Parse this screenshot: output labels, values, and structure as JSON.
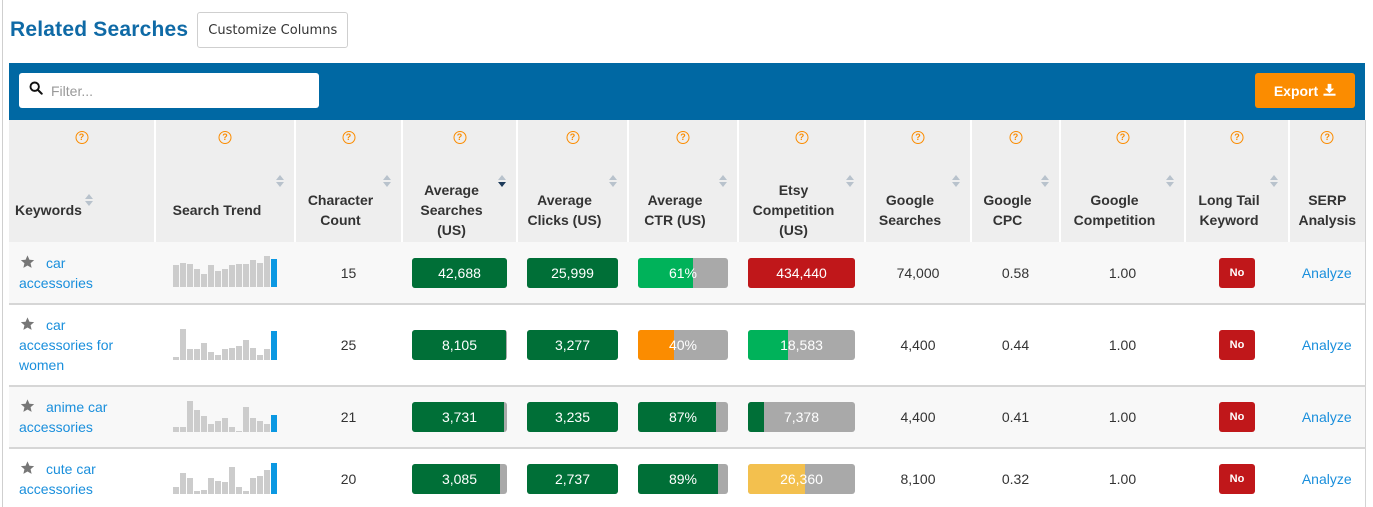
{
  "header": {
    "title": "Related Searches",
    "customize_label": "Customize Columns"
  },
  "toolbar": {
    "filter_placeholder": "Filter...",
    "filter_value": "",
    "export_label": "Export"
  },
  "colors": {
    "brand_blue": "#0068a3",
    "title_blue": "#0f6aa6",
    "export_orange": "#fb8c00",
    "help_orange": "#fb8c00",
    "dark_green": "#006f37",
    "bright_green": "#00b25a",
    "orange": "#fb8c00",
    "yellow": "#f3c04e",
    "red": "#c0171a",
    "gray_track": "#a9a9a9",
    "spark_gray": "#cccccc",
    "spark_blue": "#0b98e2",
    "link_blue": "#1a8fdc"
  },
  "columns": [
    {
      "key": "keyword",
      "label": "Keywords",
      "sortable": true,
      "sorted": false
    },
    {
      "key": "trend",
      "label": "Search Trend",
      "sortable": true,
      "sorted": false
    },
    {
      "key": "chars",
      "label": "Character Count",
      "sortable": true,
      "sorted": false
    },
    {
      "key": "avg_searches",
      "label": "Average Searches (US)",
      "sortable": true,
      "sorted": "desc"
    },
    {
      "key": "avg_clicks",
      "label": "Average Clicks (US)",
      "sortable": true,
      "sorted": false
    },
    {
      "key": "avg_ctr",
      "label": "Average CTR (US)",
      "sortable": true,
      "sorted": false
    },
    {
      "key": "etsy_comp",
      "label": "Etsy Competition (US)",
      "sortable": true,
      "sorted": false
    },
    {
      "key": "google_searches",
      "label": "Google Searches",
      "sortable": true,
      "sorted": false
    },
    {
      "key": "google_cpc",
      "label": "Google CPC",
      "sortable": true,
      "sorted": false
    },
    {
      "key": "google_comp",
      "label": "Google Competition",
      "sortable": true,
      "sorted": false
    },
    {
      "key": "long_tail",
      "label": "Long Tail Keyword",
      "sortable": true,
      "sorted": false
    },
    {
      "key": "serp",
      "label": "SERP Analysis",
      "sortable": false,
      "sorted": false
    }
  ],
  "rows": [
    {
      "keyword": "car accessories",
      "trend": [
        8,
        9,
        8.5,
        6.5,
        5,
        8,
        6,
        6.5,
        8,
        8.5,
        8.5,
        10,
        9,
        11.5,
        10.5
      ],
      "chars": "15",
      "avg_searches": {
        "text": "42,688",
        "fill": 1.0,
        "color": "#006f37"
      },
      "avg_clicks": {
        "text": "25,999",
        "fill": 1.0,
        "color": "#006f37"
      },
      "avg_ctr": {
        "text": "61%",
        "fill": 0.61,
        "color": "#00b25a"
      },
      "etsy_comp": {
        "text": "434,440",
        "fill": 1.0,
        "color": "#c0171a"
      },
      "google_searches": "74,000",
      "google_cpc": "0.58",
      "google_comp": "1.00",
      "long_tail": "No",
      "serp": "Analyze"
    },
    {
      "keyword": "car accessories for women",
      "trend": [
        1,
        10,
        3.5,
        3.5,
        5.5,
        2.5,
        1.5,
        3.5,
        4,
        4.5,
        6.5,
        4,
        1.5,
        3.5,
        9.5
      ],
      "chars": "25",
      "avg_searches": {
        "text": "8,105",
        "fill": 0.99,
        "color": "#006f37"
      },
      "avg_clicks": {
        "text": "3,277",
        "fill": 1.0,
        "color": "#006f37"
      },
      "avg_ctr": {
        "text": "40%",
        "fill": 0.4,
        "color": "#fb8c00"
      },
      "etsy_comp": {
        "text": "18,583",
        "fill": 0.37,
        "color": "#00b25a"
      },
      "google_searches": "4,400",
      "google_cpc": "0.44",
      "google_comp": "1.00",
      "long_tail": "No",
      "serp": "Analyze"
    },
    {
      "keyword": "anime car accessories",
      "trend": [
        1.5,
        1.5,
        10,
        7,
        5,
        2.5,
        3.5,
        4.5,
        1.5,
        0.3,
        8,
        4.5,
        3.5,
        2.5,
        5.5
      ],
      "chars": "21",
      "avg_searches": {
        "text": "3,731",
        "fill": 0.97,
        "color": "#006f37"
      },
      "avg_clicks": {
        "text": "3,235",
        "fill": 1.0,
        "color": "#006f37"
      },
      "avg_ctr": {
        "text": "87%",
        "fill": 0.87,
        "color": "#006f37"
      },
      "etsy_comp": {
        "text": "7,378",
        "fill": 0.15,
        "color": "#006f37"
      },
      "google_searches": "4,400",
      "google_cpc": "0.41",
      "google_comp": "1.00",
      "long_tail": "No",
      "serp": "Analyze"
    },
    {
      "keyword": "cute car accessories",
      "trend": [
        2.5,
        7,
        5.5,
        1,
        1.5,
        5.5,
        4.5,
        4,
        9,
        2.5,
        1,
        5.5,
        6,
        8,
        10.5
      ],
      "chars": "20",
      "avg_searches": {
        "text": "3,085",
        "fill": 0.93,
        "color": "#006f37"
      },
      "avg_clicks": {
        "text": "2,737",
        "fill": 1.0,
        "color": "#006f37"
      },
      "avg_ctr": {
        "text": "89%",
        "fill": 0.89,
        "color": "#006f37"
      },
      "etsy_comp": {
        "text": "26,360",
        "fill": 0.53,
        "color": "#f3c04e"
      },
      "google_searches": "8,100",
      "google_cpc": "0.32",
      "google_comp": "1.00",
      "long_tail": "No",
      "serp": "Analyze"
    }
  ]
}
